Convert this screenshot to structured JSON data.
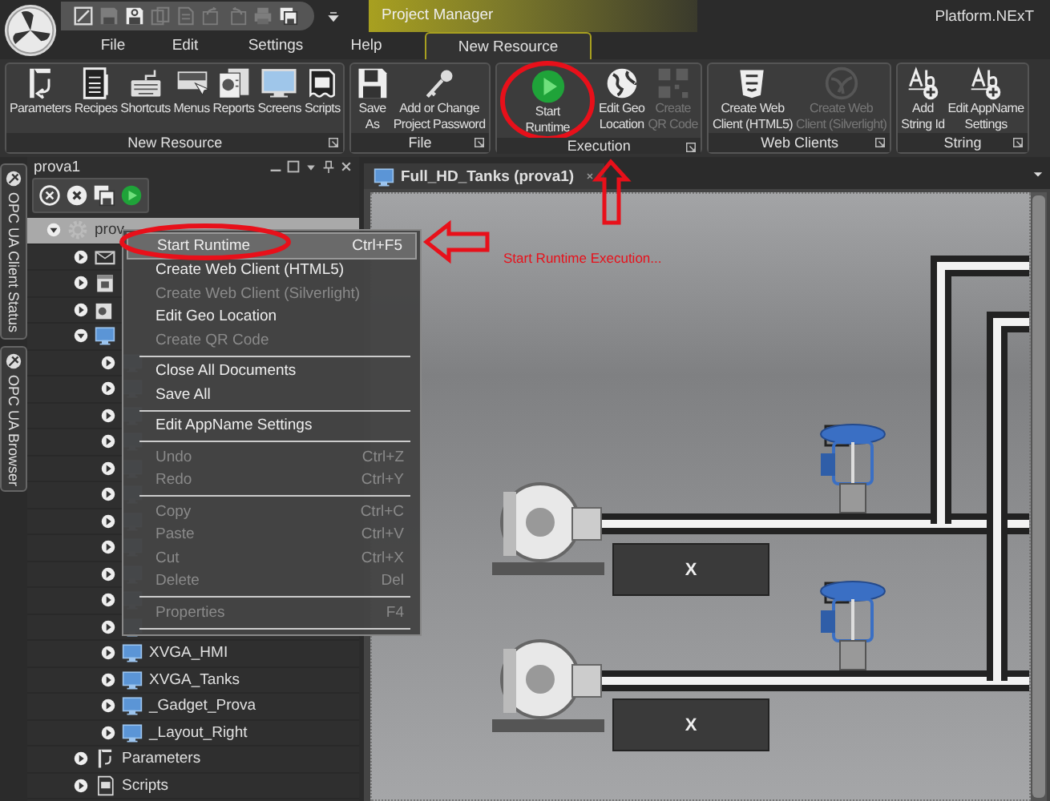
{
  "title_bar": {
    "tab": "Project Manager",
    "app_name": "Platform.NExT"
  },
  "menu_bar": [
    {
      "label": "File",
      "selected": false
    },
    {
      "label": "Edit",
      "selected": false
    },
    {
      "label": "Settings",
      "selected": false
    },
    {
      "label": "Help",
      "selected": false
    },
    {
      "label": "New Resource",
      "selected": true
    }
  ],
  "ribbon": [
    {
      "title": "New Resource",
      "buttons": [
        {
          "label": "Parameters",
          "disabled": false
        },
        {
          "label": "Recipes",
          "disabled": false
        },
        {
          "label": "Shortcuts",
          "disabled": false
        },
        {
          "label": "Menus",
          "disabled": false
        },
        {
          "label": "Reports",
          "disabled": false
        },
        {
          "label": "Screens",
          "disabled": false
        },
        {
          "label": "Scripts",
          "disabled": false
        }
      ]
    },
    {
      "title": "File",
      "buttons": [
        {
          "label": "Save\nAs",
          "disabled": false
        },
        {
          "label": "Add or Change\nProject Password",
          "disabled": false
        }
      ]
    },
    {
      "title": "Execution",
      "buttons": [
        {
          "label": "Start\nRuntime",
          "disabled": false
        },
        {
          "label": "Edit Geo\nLocation",
          "disabled": false
        },
        {
          "label": "Create\nQR Code",
          "disabled": true
        }
      ]
    },
    {
      "title": "Web Clients",
      "buttons": [
        {
          "label": "Create Web\nClient (HTML5)",
          "disabled": false
        },
        {
          "label": "Create Web\nClient (Silverlight)",
          "disabled": true
        }
      ]
    },
    {
      "title": "String",
      "buttons": [
        {
          "label": "Add\nString Id",
          "disabled": false
        },
        {
          "label": "Edit AppName\nSettings",
          "disabled": false
        }
      ]
    }
  ],
  "side_tabs": [
    "OPC UA Client Status",
    "OPC UA Browser"
  ],
  "panel": {
    "title": "prova1",
    "tree": [
      {
        "kind": "project",
        "label": "prov",
        "expanded": true,
        "selected": true,
        "children": [
          {
            "kind": "alarms",
            "expanded": false,
            "selected": false
          },
          {
            "kind": "scheduler",
            "expanded": false,
            "selected": false
          },
          {
            "kind": "reports",
            "expanded": false,
            "selected": false
          },
          {
            "kind": "screens",
            "expanded": true,
            "selected": false,
            "children": [
              {
                "kind": "screen",
                "expanded": false,
                "selected": false
              },
              {
                "kind": "screen",
                "expanded": false,
                "selected": false
              },
              {
                "kind": "screen",
                "expanded": false,
                "selected": false
              },
              {
                "kind": "screen",
                "expanded": false,
                "selected": false
              },
              {
                "kind": "screen",
                "expanded": false,
                "selected": false
              },
              {
                "kind": "screen",
                "expanded": false,
                "selected": false
              },
              {
                "kind": "screen",
                "expanded": false,
                "selected": false
              },
              {
                "kind": "screen",
                "expanded": false,
                "selected": false
              },
              {
                "kind": "screen",
                "expanded": false,
                "selected": false
              },
              {
                "kind": "screen",
                "expanded": false,
                "selected": false
              },
              {
                "kind": "screen",
                "expanded": false,
                "selected": false
              },
              {
                "kind": "screen",
                "label": "XVGA_HMI",
                "expanded": false,
                "selected": false
              },
              {
                "kind": "screen",
                "label": "XVGA_Tanks",
                "expanded": false,
                "selected": false
              },
              {
                "kind": "screen",
                "label": "_Gadget_Prova",
                "expanded": false,
                "selected": false
              },
              {
                "kind": "screen",
                "label": "_Layout_Right",
                "expanded": false,
                "selected": false
              }
            ]
          },
          {
            "kind": "parameters",
            "label": "Parameters",
            "expanded": false,
            "selected": false
          },
          {
            "kind": "scripts",
            "label": "Scripts",
            "expanded": false,
            "selected": false
          }
        ]
      }
    ]
  },
  "document_tab": {
    "label": "Full_HD_Tanks (prova1)"
  },
  "canvas": {
    "displays": [
      "X",
      "X"
    ]
  },
  "annotation": {
    "text": "Start Runtime Execution..."
  },
  "context_menu": [
    {
      "kind": "item",
      "label": "Start Runtime",
      "shortcut": "Ctrl+F5",
      "disabled": false,
      "selected": true
    },
    {
      "kind": "item",
      "label": "Create Web Client (HTML5)",
      "disabled": false,
      "selected": false
    },
    {
      "kind": "item",
      "label": "Create Web Client (Silverlight)",
      "disabled": true,
      "selected": false
    },
    {
      "kind": "item",
      "label": "Edit Geo Location",
      "disabled": false,
      "selected": false
    },
    {
      "kind": "item",
      "label": "Create QR Code",
      "disabled": true,
      "selected": false
    },
    {
      "kind": "separator"
    },
    {
      "kind": "item",
      "label": "Close All Documents",
      "disabled": false,
      "selected": false
    },
    {
      "kind": "item",
      "label": "Save All",
      "disabled": false,
      "selected": false
    },
    {
      "kind": "separator"
    },
    {
      "kind": "item",
      "label": "Edit AppName Settings",
      "disabled": false,
      "selected": false
    },
    {
      "kind": "separator"
    },
    {
      "kind": "item",
      "label": "Undo",
      "shortcut": "Ctrl+Z",
      "disabled": true,
      "selected": false
    },
    {
      "kind": "item",
      "label": "Redo",
      "shortcut": "Ctrl+Y",
      "disabled": true,
      "selected": false
    },
    {
      "kind": "separator"
    },
    {
      "kind": "item",
      "label": "Copy",
      "shortcut": "Ctrl+C",
      "disabled": true,
      "selected": false
    },
    {
      "kind": "item",
      "label": "Paste",
      "shortcut": "Ctrl+V",
      "disabled": true,
      "selected": false
    },
    {
      "kind": "item",
      "label": "Cut",
      "shortcut": "Ctrl+X",
      "disabled": true,
      "selected": false
    },
    {
      "kind": "item",
      "label": "Delete",
      "shortcut": "Del",
      "disabled": true,
      "selected": false
    },
    {
      "kind": "separator"
    },
    {
      "kind": "item",
      "label": "Properties",
      "shortcut": "F4",
      "disabled": true,
      "selected": false
    },
    {
      "kind": "separator"
    }
  ]
}
